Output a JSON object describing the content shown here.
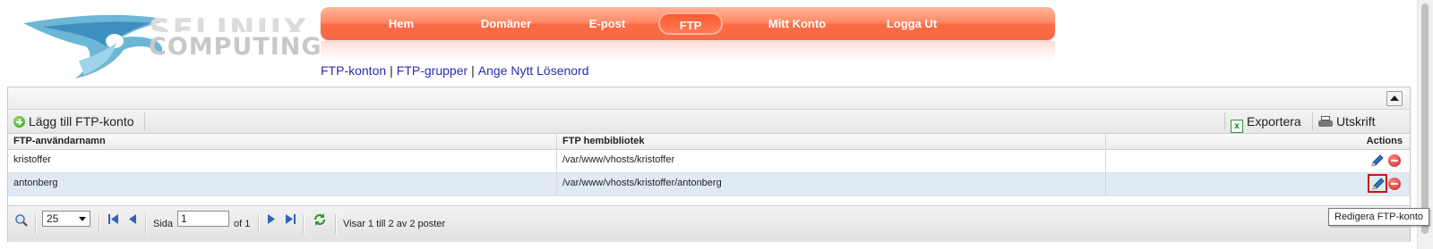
{
  "logo": {
    "text_top": "SELINUX",
    "text_bottom": "COMPUTING"
  },
  "nav": {
    "items": [
      {
        "label": "Hem"
      },
      {
        "label": "Domäner"
      },
      {
        "label": "E-post"
      },
      {
        "label": "FTP",
        "active": true
      },
      {
        "label": "Mitt Konto"
      },
      {
        "label": "Logga Ut"
      }
    ]
  },
  "subnav": {
    "links": [
      "FTP-konton",
      "FTP-grupper",
      "Ange Nytt Lösenord"
    ],
    "separator": "|"
  },
  "toolbar": {
    "add_label": "Lägg till FTP-konto",
    "export_label": "Exportera",
    "print_label": "Utskrift"
  },
  "table": {
    "columns": [
      "FTP-användarnamn",
      "FTP hembibliotek",
      "Actions"
    ],
    "rows": [
      {
        "username": "kristoffer",
        "home": "/var/www/vhosts/kristoffer"
      },
      {
        "username": "antonberg",
        "home": "/var/www/vhosts/kristoffer/antonberg",
        "selected": true
      }
    ]
  },
  "pager": {
    "page_size": "25",
    "page_label": "Sida",
    "page_value": "1",
    "of_label": "of 1",
    "status": "Visar 1 till 2 av 2 poster"
  },
  "tooltip": "Redigera FTP-konto",
  "colors": {
    "nav_orange": "#f76a47",
    "link_blue": "#2a2ab8",
    "selected_row": "#dfeaf5",
    "focus_red": "#d01010"
  }
}
